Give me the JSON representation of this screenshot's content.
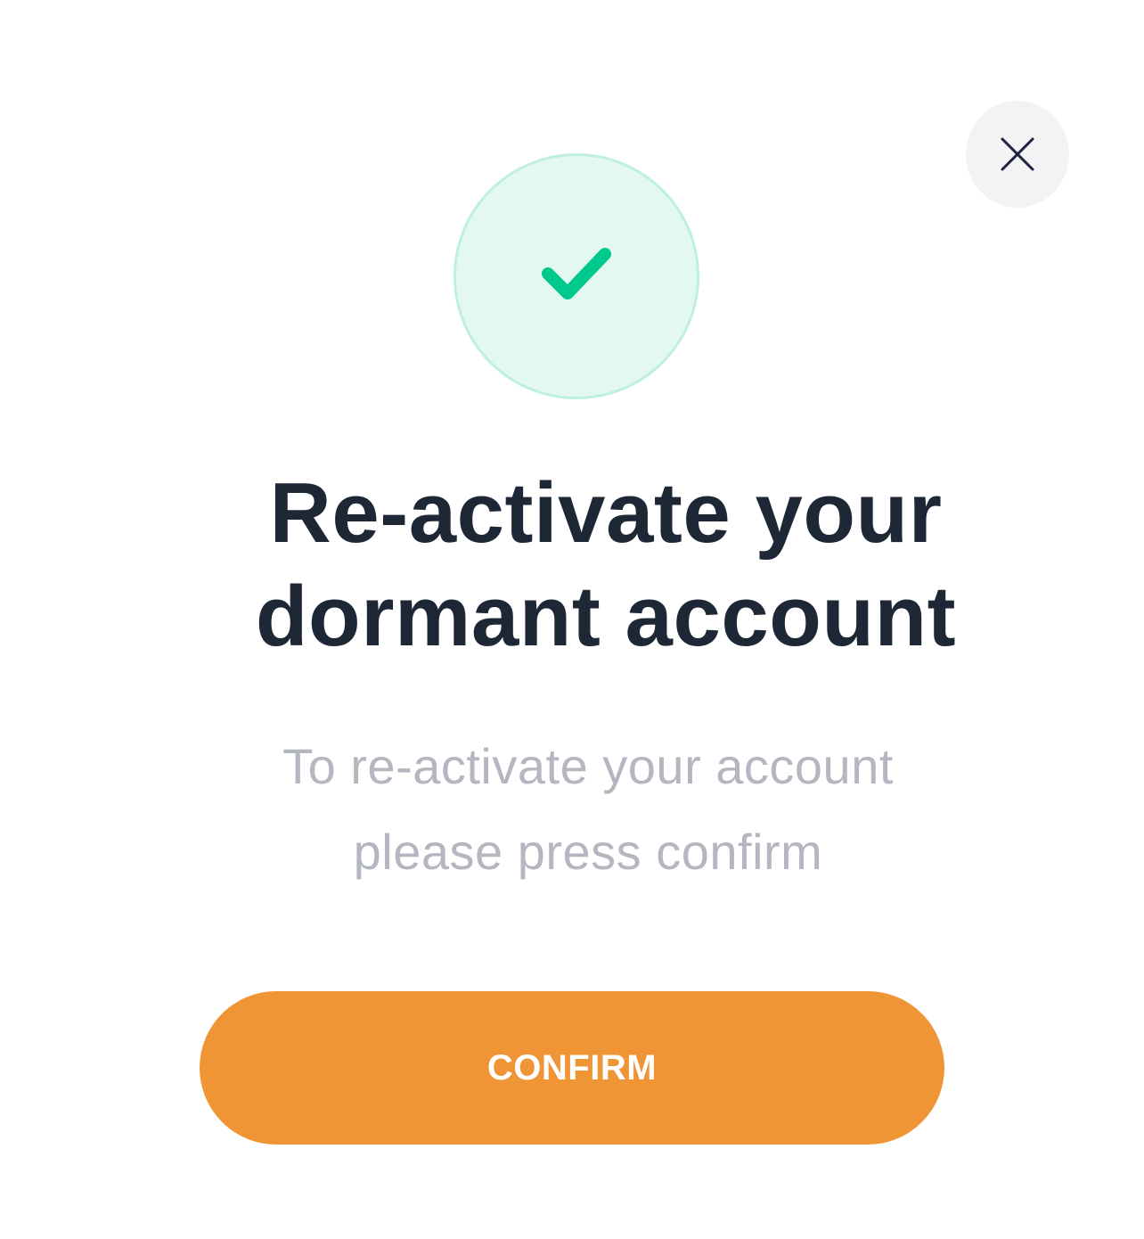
{
  "dialog": {
    "close_icon": "close-icon",
    "status_icon": "check-icon",
    "title_line1": "Re-activate your",
    "title_line2": "dormant account",
    "message_line1": "To re-activate your account",
    "message_line2": "please press confirm",
    "confirm_label": "CONFIRM"
  },
  "colors": {
    "accent": "#f09535",
    "success": "#00c98d",
    "success_bg": "#e4f8f2",
    "title": "#1e2735",
    "muted": "#b4b7c0"
  }
}
